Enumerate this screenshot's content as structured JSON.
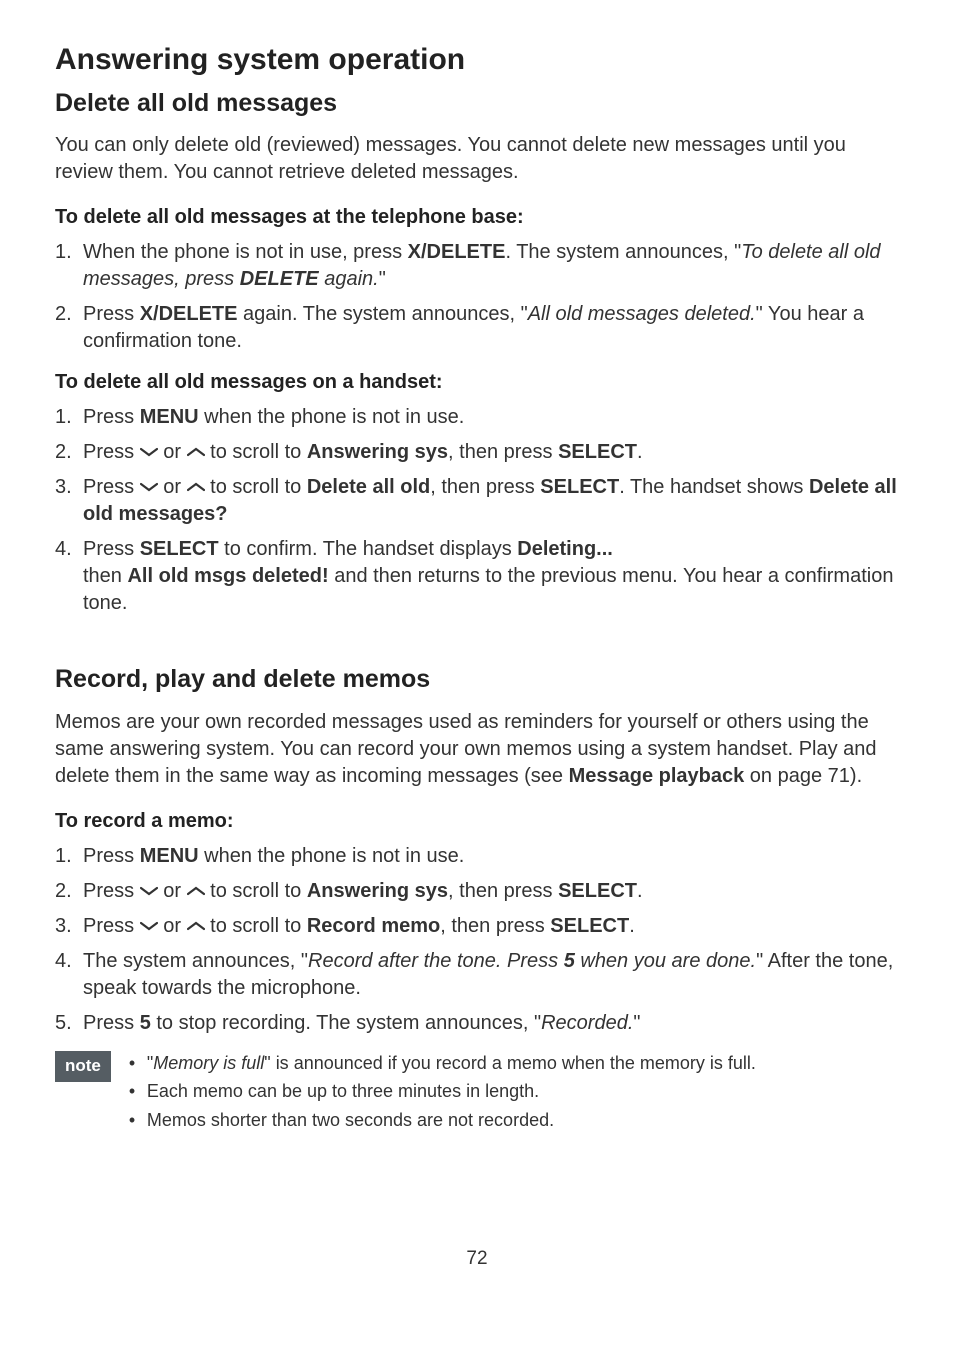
{
  "page_number": "72",
  "h1": "Answering system operation",
  "sec1": {
    "title": "Delete all old messages",
    "intro": "You can only delete old (reviewed) messages. You cannot delete new messages until you review them. You cannot retrieve deleted messages.",
    "sub1": "To delete all old messages at the telephone base:",
    "s1a_pre": "When the phone is not in use, press ",
    "s1a_btn": "X/DELETE",
    "s1a_mid": ". The system announces, \"",
    "s1a_it1": "To delete all old messages, press ",
    "s1a_bi": "DELETE",
    "s1a_it2": " again.",
    "s1a_end": "\"",
    "s1b_pre": "Press ",
    "s1b_btn": "X/DELETE",
    "s1b_mid": " again. The system announces, \"",
    "s1b_it": "All old messages deleted.",
    "s1b_end": "\" You hear a confirmation tone.",
    "sub2": "To delete all old messages on a handset:",
    "s2a_pre": "Press ",
    "s2a_btn": "MENU",
    "s2a_end": " when the phone is not in use.",
    "s2b_pre": "Press ",
    "s2b_or": " or ",
    "s2b_mid": " to scroll to ",
    "s2b_b1": "Answering sys",
    "s2b_mid2": ", then press ",
    "s2b_b2": "SELECT",
    "s2b_end": ".",
    "s2c_pre": "Press ",
    "s2c_or": " or ",
    "s2c_mid": " to scroll to ",
    "s2c_b1": "Delete all old",
    "s2c_mid2": ", then press ",
    "s2c_b2": "SELECT",
    "s2c_mid3": ". The handset shows ",
    "s2c_b3": "Delete all old messages?",
    "s2d_pre": "Press ",
    "s2d_b1": "SELECT",
    "s2d_mid": " to confirm. The handset displays ",
    "s2d_b2": "Deleting...",
    "s2d_mid2": " then ",
    "s2d_b3": "All old msgs deleted!",
    "s2d_end": " and then returns to the previous menu. You hear a confirmation tone."
  },
  "sec2": {
    "title": "Record, play and delete memos",
    "intro_pre": "Memos are your own recorded messages used as reminders for yourself or others using the same answering system. You can record your own memos using a system handset. Play and delete them in the same way as incoming messages (see ",
    "intro_b": "Message playback",
    "intro_end": " on page 71).",
    "sub1": "To record a memo:",
    "r1_pre": "Press ",
    "r1_b": "MENU",
    "r1_end": " when the phone is not in use.",
    "r2_pre": "Press ",
    "r2_or": " or ",
    "r2_mid": " to scroll to ",
    "r2_b1": "Answering sys",
    "r2_mid2": ", then press ",
    "r2_b2": "SELECT",
    "r2_end": ".",
    "r3_pre": "Press ",
    "r3_or": " or ",
    "r3_mid": " to scroll to ",
    "r3_b1": "Record memo",
    "r3_mid2": ", then press ",
    "r3_b2": "SELECT",
    "r3_end": ".",
    "r4_pre": "The system announces, \"",
    "r4_it1": "Record after the tone. Press ",
    "r4_bi": "5",
    "r4_it2": " when you are done.",
    "r4_end": "\" After the tone, speak towards the microphone.",
    "r5_pre": "Press ",
    "r5_b": "5",
    "r5_mid": " to stop recording. The system announces, \"",
    "r5_it": "Recorded.",
    "r5_end": "\""
  },
  "note_label": "note",
  "notes": {
    "n1_pre": "\"",
    "n1_it": "Memory is full",
    "n1_end": "\" is announced if you record a memo when the memory is full.",
    "n2": "Each memo can be up to three minutes in length.",
    "n3": "Memos shorter than two seconds are not recorded."
  }
}
